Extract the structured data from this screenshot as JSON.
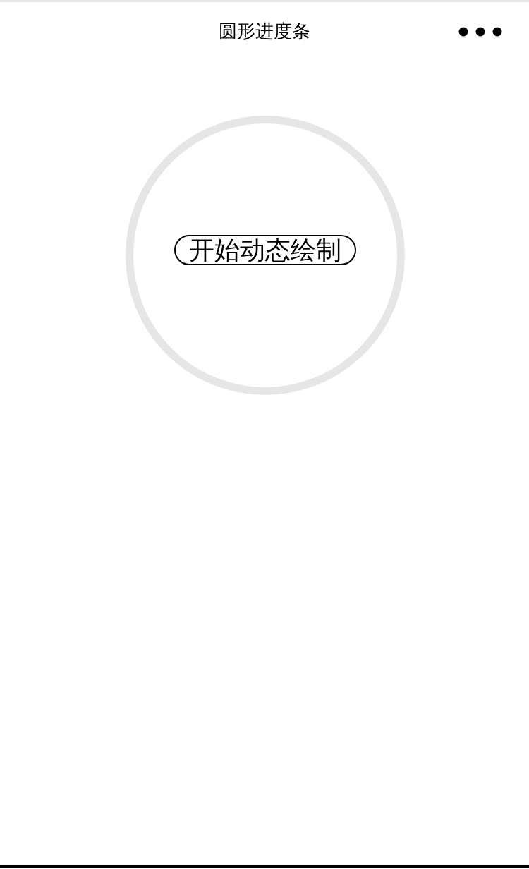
{
  "nav_bar": {
    "title": "圆形进度条"
  },
  "progress_ring": {
    "button": {
      "label": "开始动态绘制"
    }
  }
}
